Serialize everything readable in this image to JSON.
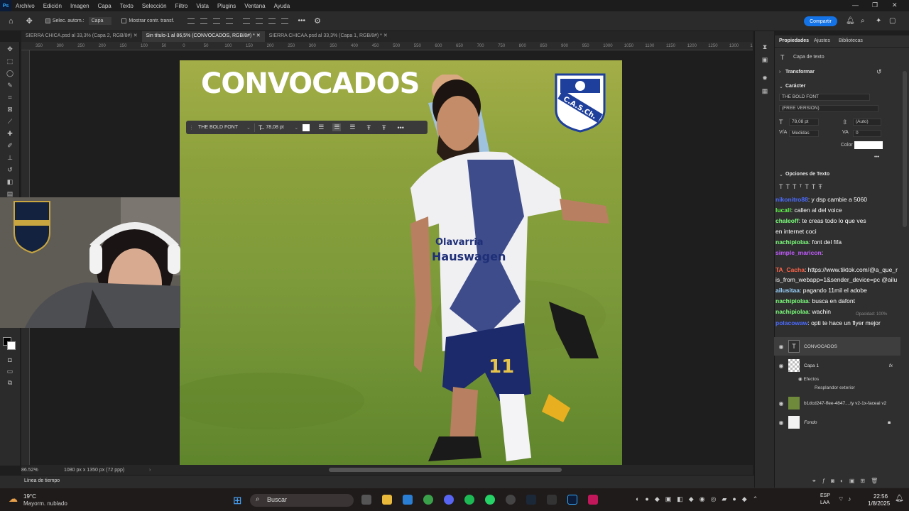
{
  "menubar": {
    "items": [
      "Archivo",
      "Edición",
      "Imagen",
      "Capa",
      "Texto",
      "Selección",
      "Filtro",
      "Vista",
      "Plugins",
      "Ventana",
      "Ayuda"
    ]
  },
  "options": {
    "auto_select": "Selec. autom.:",
    "layer_mode": "Capa",
    "show_transform": "Mostrar contr. transf.",
    "more": "•••",
    "share": "Compartir"
  },
  "tabs": [
    "SIERRA CHICA.psd al 33,3% (Capa 2, RGB/8#)",
    "Sin título-1 al 86,5% (CONVOCADOS, RGB/8#) *",
    "SIERRA CHICAA.psd al 33,3% (Capa 1, RGB/8#) *"
  ],
  "ruler": [
    "350",
    "300",
    "250",
    "200",
    "150",
    "100",
    "50",
    "0",
    "50",
    "100",
    "150",
    "200",
    "250",
    "300",
    "350",
    "400",
    "450",
    "500",
    "550",
    "600",
    "650",
    "700",
    "750",
    "800",
    "850",
    "900",
    "950",
    "1000",
    "1050",
    "1100",
    "1150",
    "1200",
    "1250",
    "1300",
    "1350",
    "1400"
  ],
  "canvas": {
    "title": "CONVOCADOS",
    "crest_text": "C.A.S.Ch.",
    "shirt_text_1": "Olavarria",
    "shirt_text_2": "Hauswagen",
    "shorts_number": "11"
  },
  "text_bar": {
    "font": "THE BOLD FONT",
    "size": "78,08 pt"
  },
  "status": {
    "zoom": "86.52%",
    "doc": "1080 px x 1350 px (72 ppp)"
  },
  "timeline": "Línea de tiempo",
  "props": {
    "tab_props": "Propiedades",
    "tab_adjust": "Ajustes",
    "tab_lib": "Bibliotecas",
    "layer_type": "Capa de texto",
    "transform": "Transformar",
    "character": "Carácter",
    "font": "THE BOLD FONT",
    "style": "(FREE VERSION)",
    "size": "78,08 pt",
    "leading": "(Auto)",
    "kerning": "Medidas",
    "tracking": "0",
    "color_label": "Color",
    "text_options": "Opciones de Texto",
    "more": "•••"
  },
  "chat": [
    {
      "user": "nikonitro88",
      "msg": ": y dsp cambie a 5060",
      "color": "#4b6bff"
    },
    {
      "user": "lucall",
      "msg": ": callen al del voice",
      "color": "#62ff4b"
    },
    {
      "user": "chaleoff",
      "msg": ": te creas todo lo que ves",
      "color": "#7cff7c"
    },
    {
      "user": "",
      "msg": "en internet coci",
      "color": "#fff"
    },
    {
      "user": "nachipiolaa",
      "msg": ": font del fifa",
      "color": "#7cff7c"
    },
    {
      "user": "simple_maricon",
      "msg": ":",
      "color": "#c25bff"
    },
    {
      "user": "TA_Cacha",
      "msg": ": https://www.tiktok.com/@a_que_r",
      "color": "#ff6347"
    },
    {
      "user": "",
      "msg": "is_from_webapp=1&sender_device=pc @ailu",
      "color": "#fff"
    },
    {
      "user": "ailusitaa",
      "msg": ": pagando 11mil el adobe",
      "color": "#9bd4ff"
    },
    {
      "user": "nachipiolaa",
      "msg": ": busca en dafont",
      "color": "#7cff7c"
    },
    {
      "user": "nachipiolaa",
      "msg": ": wachin",
      "color": "#7cff7c"
    },
    {
      "user": "polacowaw",
      "msg": ": opti te hace un flyer mejor",
      "color": "#4b6bff"
    }
  ],
  "layers": {
    "convocados": "CONVOCADOS",
    "capa1": "Capa 1",
    "effects": "Efectos",
    "glow": "Resplandor exterior",
    "image": "b1dcd247-ffee-4847....ty v2-1x-faceai v2",
    "bg": "Fondo",
    "fx": "fx",
    "opacity": "Opacidad: 100%"
  },
  "taskbar": {
    "temp": "19°C",
    "weather": "Mayorm. nublado",
    "search": "Buscar",
    "lang1": "ESP",
    "lang2": "LAA",
    "time": "22:56",
    "date": "1/8/2025"
  }
}
